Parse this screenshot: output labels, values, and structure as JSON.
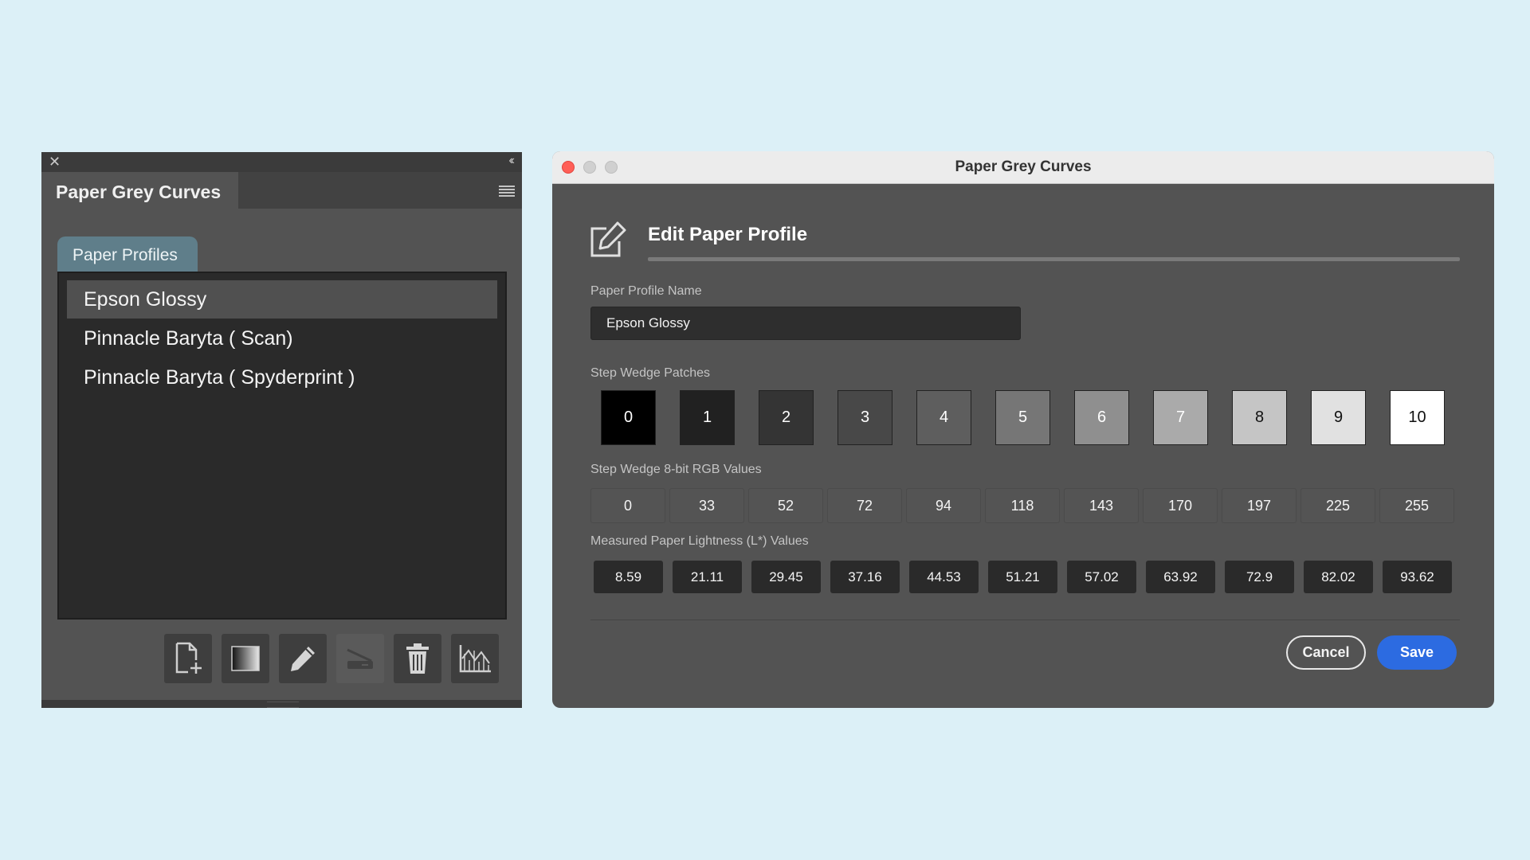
{
  "panel": {
    "close_glyph": "✕",
    "collapse_glyph": "‹‹",
    "tab_title": "Paper Grey Curves",
    "subtab_label": "Paper Profiles",
    "profiles": [
      {
        "label": "Epson Glossy",
        "selected": true
      },
      {
        "label": "Pinnacle Baryta ( Scan)",
        "selected": false
      },
      {
        "label": "Pinnacle Baryta ( Spyderprint )",
        "selected": false
      }
    ],
    "toolbar": [
      {
        "icon": "new-document-icon",
        "enabled": true
      },
      {
        "icon": "gradient-icon",
        "enabled": true
      },
      {
        "icon": "pencil-icon",
        "enabled": true
      },
      {
        "icon": "scanner-icon",
        "enabled": false
      },
      {
        "icon": "trash-icon",
        "enabled": true
      },
      {
        "icon": "graph-icon",
        "enabled": true
      }
    ]
  },
  "dialog": {
    "window_title": "Paper Grey Curves",
    "heading": "Edit Paper Profile",
    "name_label": "Paper Profile Name",
    "name_value": "Epson Glossy",
    "patches_label": "Step Wedge Patches",
    "patches": [
      "0",
      "1",
      "2",
      "3",
      "4",
      "5",
      "6",
      "7",
      "8",
      "9",
      "10"
    ],
    "rgb_label": "Step Wedge 8-bit RGB Values",
    "rgb_values": [
      "0",
      "33",
      "52",
      "72",
      "94",
      "118",
      "143",
      "170",
      "197",
      "225",
      "255"
    ],
    "lightness_label": "Measured Paper Lightness (L*) Values",
    "lightness_values": [
      "8.59",
      "21.11",
      "29.45",
      "37.16",
      "44.53",
      "51.21",
      "57.02",
      "63.92",
      "72.9",
      "82.02",
      "93.62"
    ],
    "cancel_label": "Cancel",
    "save_label": "Save",
    "accent_color": "#2c6be1"
  }
}
